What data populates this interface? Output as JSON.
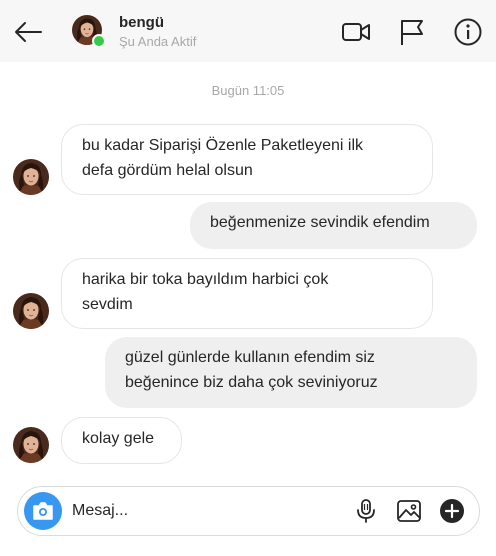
{
  "header": {
    "name": "bengü",
    "status": "Şu Anda Aktif",
    "icons": [
      "back-arrow-icon",
      "video-camera-icon",
      "flag-icon",
      "info-icon"
    ]
  },
  "conversation": {
    "timestamp": "Bugün 11:05",
    "messages": [
      {
        "from": "them",
        "lines": [
          "bu kadar Siparişi Özenle Paketleyeni ilk",
          "defa gördüm helal olsun"
        ]
      },
      {
        "from": "me",
        "lines": [
          "beğenmenize sevindik efendim"
        ]
      },
      {
        "from": "them",
        "lines": [
          "harika bir toka bayıldım harbici çok",
          "sevdim"
        ]
      },
      {
        "from": "me",
        "lines": [
          "güzel günlerde kullanın efendim siz",
          "beğenince biz daha çok seviniyoruz"
        ]
      },
      {
        "from": "them",
        "lines": [
          "kolay gele"
        ]
      }
    ]
  },
  "composer": {
    "placeholder": "Mesaj...",
    "icons": [
      "camera-icon",
      "microphone-icon",
      "image-icon",
      "add-icon"
    ]
  },
  "colors": {
    "online": "#36c94b",
    "camera_button": "#3897f0",
    "outgoing_bubble": "#efefef",
    "header_bg": "#f7f7f7"
  }
}
